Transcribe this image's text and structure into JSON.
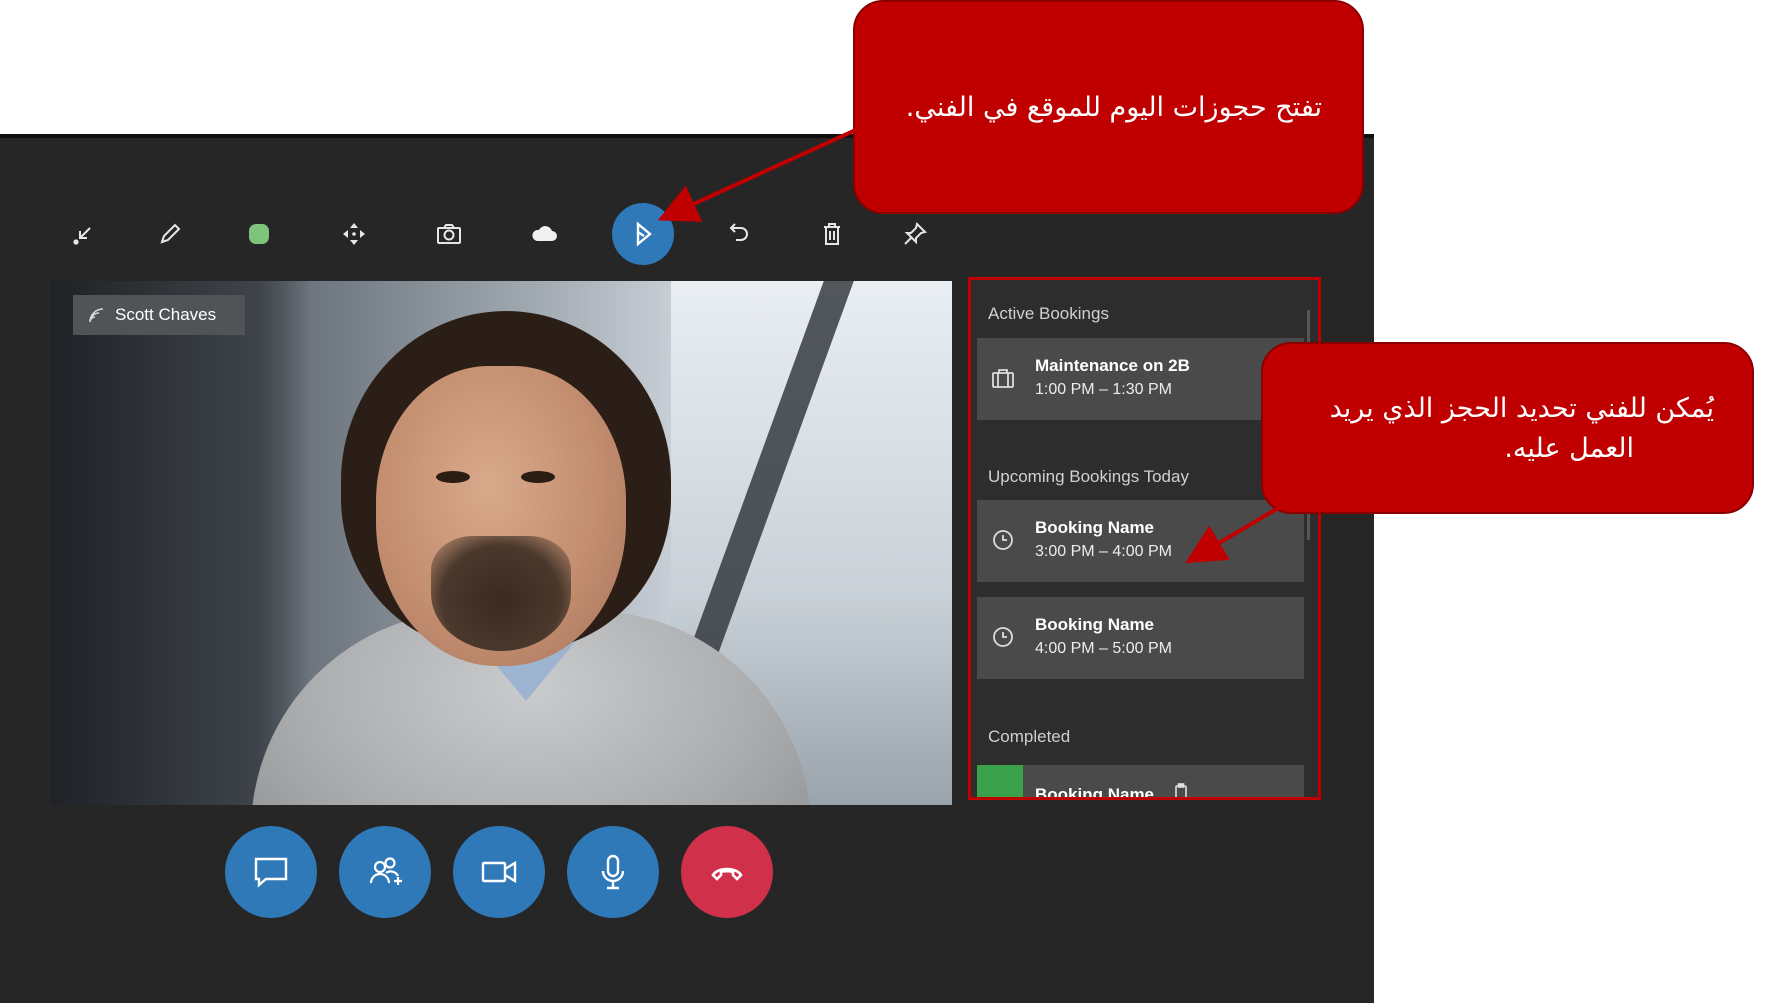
{
  "video": {
    "participant_name": "Scott Chaves"
  },
  "bookings_panel": {
    "active_title": "Active Bookings",
    "active": [
      {
        "name": "Maintenance on 2B",
        "time": "1:00 PM – 1:30 PM",
        "icon": "briefcase-icon"
      }
    ],
    "upcoming_title": "Upcoming Bookings Today",
    "upcoming": [
      {
        "name": "Booking Name",
        "time": "3:00 PM – 4:00 PM",
        "icon": "clock-icon"
      },
      {
        "name": "Booking Name",
        "time": "4:00 PM – 5:00 PM",
        "icon": "clock-icon"
      }
    ],
    "completed_title": "Completed",
    "completed": [
      {
        "name": "Booking Name",
        "icon": "clipboard-icon",
        "status_color": "#3aa04a"
      }
    ]
  },
  "toolbar": {
    "tools": [
      "minimize-icon",
      "pen-icon",
      "color-dot-icon",
      "move-icon",
      "camera-icon",
      "cloud-icon",
      "dynamics-icon",
      "undo-icon",
      "delete-icon",
      "pin-icon"
    ],
    "active_tool": "dynamics-icon",
    "ink_color": "#7dc47d"
  },
  "call_controls": [
    "chat-icon",
    "add-participant-icon",
    "video-icon",
    "microphone-icon",
    "end-call-icon"
  ],
  "callouts": {
    "top": "تفتح حجوزات اليوم للموقع في الفني.",
    "right_line1": "يُمكن للفني تحديد الحجز الذي يريد",
    "right_line2": "العمل عليه."
  },
  "colors": {
    "accent": "#2f79b9",
    "end_call": "#d0304a",
    "callout": "#c00000",
    "highlight_border": "#c00000"
  }
}
